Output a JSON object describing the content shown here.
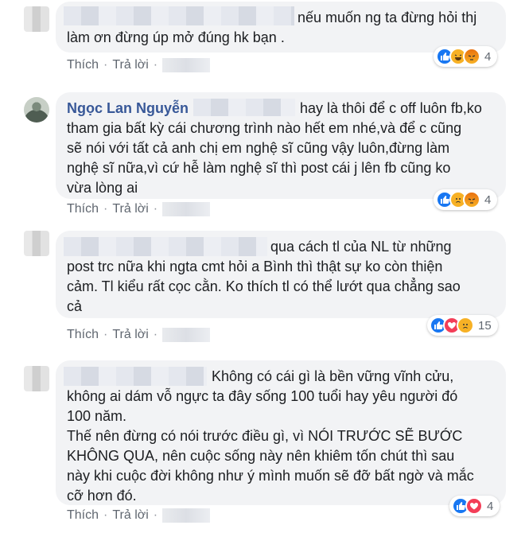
{
  "comments": [
    {
      "author": "",
      "text_lines": [
        "nếu muốn ng ta đừng hỏi thj",
        "làm ơn đừng úp mở đúng hk bạn ."
      ],
      "like_label": "Thích",
      "reply_label": "Trả lời",
      "dot": "·",
      "reactions": [
        "like",
        "haha",
        "angry"
      ],
      "reaction_count": "4"
    },
    {
      "author": "Ngọc Lan Nguyễn",
      "text_lines": [
        "hay là thôi để c off luôn fb,ko",
        "tham gia bất kỳ cái chương trình nào hết em nhé,và để c cũng",
        "sẽ nói với tất cả anh chị em nghệ sĩ cũng vậy luôn,đừng làm",
        "nghệ sĩ nữa,vì cứ hễ làm nghệ sĩ thì post cái j lên fb cũng ko",
        "vừa lòng ai"
      ],
      "like_label": "Thích",
      "reply_label": "Trả lời",
      "dot": "·",
      "reactions": [
        "like",
        "sad",
        "angry"
      ],
      "reaction_count": "4"
    },
    {
      "author": "",
      "text_lines": [
        "qua cách tl của NL từ những",
        "post trc nữa khi ngta cmt hỏi a Bình thì thật sự ko còn thiện",
        "cảm. Tl kiểu rất cọc cằn. Ko thích tl có thể lướt qua chẳng sao",
        "cả"
      ],
      "like_label": "Thích",
      "reply_label": "Trả lời",
      "dot": "·",
      "reactions": [
        "like",
        "love",
        "sad"
      ],
      "reaction_count": "15"
    },
    {
      "author": "",
      "text_lines": [
        "Không có cái gì là bền vững vĩnh cửu,",
        "không ai dám vỗ ngực ta đây sống 100 tuổi hay yêu người đó",
        "100 năm.",
        "Thế nên đừng có nói trước điều gì, vì NÓI TRƯỚC SẼ BƯỚC",
        "KHÔNG QUA, nên cuộc sống này nên khiêm tốn chút thì sau",
        "này khi cuộc đời không như ý mình muốn sẽ đỡ bất ngờ và mắc",
        "cỡ hơn đó."
      ],
      "like_label": "Thích",
      "reply_label": "Trả lời",
      "dot": "·",
      "reactions": [
        "like",
        "love"
      ],
      "reaction_count": "4"
    }
  ],
  "colors": {
    "bubble": "#f2f3f5",
    "name": "#385898",
    "meta": "#606770",
    "like": "#1877f2",
    "love": "#f33e58",
    "haha": "#f7b125"
  }
}
